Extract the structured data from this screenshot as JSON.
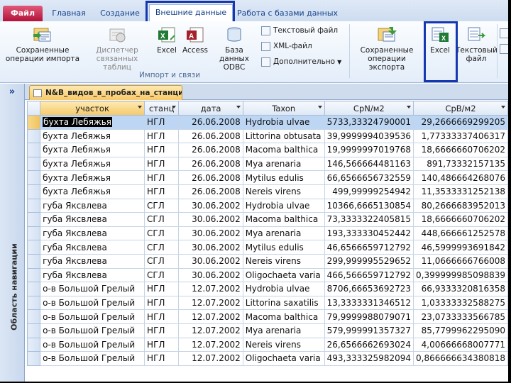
{
  "ribbon_tabs": {
    "file": "Файл",
    "home": "Главная",
    "create": "Создание",
    "external": "Внешние данные",
    "database_tools": "Работа с базами данных"
  },
  "ribbon": {
    "saved_imports": "Сохраненные\nоперации импорта",
    "linked_table_manager": "Диспетчер\nсвязанных таблиц",
    "import_excel": "Excel",
    "import_access": "Access",
    "import_odbc": "База данных\nODBC",
    "text_file": "Текстовый файл",
    "xml_file": "XML-файл",
    "more": "Дополнительно",
    "group_import": "Импорт и связи",
    "saved_exports": "Сохраненные\nоперации экспорта",
    "export_excel": "Excel",
    "export_text": "Текстовый\nфайл"
  },
  "nav_pane": {
    "toggle": "»",
    "label": "Область навигации"
  },
  "document_tab": "N&B_видов_в_пробах_на_станциях",
  "table": {
    "columns": [
      "участок",
      "станц",
      "дата",
      "Taxon",
      "CpN/м2",
      "CpB/м2"
    ],
    "rows": [
      [
        "бухта Лебяжья",
        "НГЛ",
        "26.06.2008",
        "Hydrobia ulvae",
        "5733,33324790001",
        "29,2666669299205"
      ],
      [
        "бухта Лебяжья",
        "НГЛ",
        "26.06.2008",
        "Littorina obtusata",
        "39,9999994039536",
        "1,77333337406317"
      ],
      [
        "бухта Лебяжья",
        "НГЛ",
        "26.06.2008",
        "Macoma balthica",
        "19,9999997019768",
        "18,6666660706202"
      ],
      [
        "бухта Лебяжья",
        "НГЛ",
        "26.06.2008",
        "Mya arenaria",
        "146,566664481163",
        "891,73332157135"
      ],
      [
        "бухта Лебяжья",
        "НГЛ",
        "26.06.2008",
        "Mytilus edulis",
        "66,6566656732559",
        "140,486664268076"
      ],
      [
        "бухта Лебяжья",
        "НГЛ",
        "26.06.2008",
        "Nereis virens",
        "499,99999254942",
        "11,3533331252138"
      ],
      [
        "губа Яксвлева",
        "СГЛ",
        "30.06.2002",
        "Hydrobia ulvae",
        "10366,6665130854",
        "80,2666683952013"
      ],
      [
        "губа Яксвлева",
        "СГЛ",
        "30.06.2002",
        "Macoma balthica",
        "73,3333322405815",
        "18,6666660706202"
      ],
      [
        "губа Яксвлева",
        "СГЛ",
        "30.06.2002",
        "Mya arenaria",
        "193,333330452442",
        "448,666661252578"
      ],
      [
        "губа Яксвлева",
        "СГЛ",
        "30.06.2002",
        "Mytilus edulis",
        "46,6566659712792",
        "46,5999993691842"
      ],
      [
        "губа Яксвлева",
        "СГЛ",
        "30.06.2002",
        "Nereis virens",
        "299,999995529652",
        "11,0666666766008"
      ],
      [
        "губа Яксвлева",
        "СГЛ",
        "30.06.2002",
        "Oligochaeta varia",
        "466,566659712792",
        "0,399999985098839"
      ],
      [
        "о-в Большой Грелый",
        "НГЛ",
        "12.07.2002",
        "Hydrobia ulvae",
        "8706,66653692723",
        "66,9333320816358"
      ],
      [
        "о-в Большой Грелый",
        "НГЛ",
        "12.07.2002",
        "Littorina saxatilis",
        "13,3333331346512",
        "1,03333332588275"
      ],
      [
        "о-в Большой Грелый",
        "НГЛ",
        "12.07.2002",
        "Macoma balthica",
        "79,9999988079071",
        "23,0733333566785"
      ],
      [
        "о-в Большой Грелый",
        "НГЛ",
        "12.07.2002",
        "Mya arenaria",
        "579,999991357327",
        "85,7799962295090"
      ],
      [
        "о-в Большой Грелый",
        "НГЛ",
        "12.07.2002",
        "Nereis virens",
        "26,6566662693024",
        "4,00666668007771"
      ],
      [
        "о-в Большой Грелый",
        "НГЛ",
        "12.07.2002",
        "Oligochaeta varia",
        "493,333325982094",
        "0,866666634380818"
      ]
    ]
  },
  "colors": {
    "highlight_box": "#1537b0",
    "current_row": "#bcd6f4",
    "file_tab": "#b3113a",
    "doc_tab": "#f8c968"
  }
}
